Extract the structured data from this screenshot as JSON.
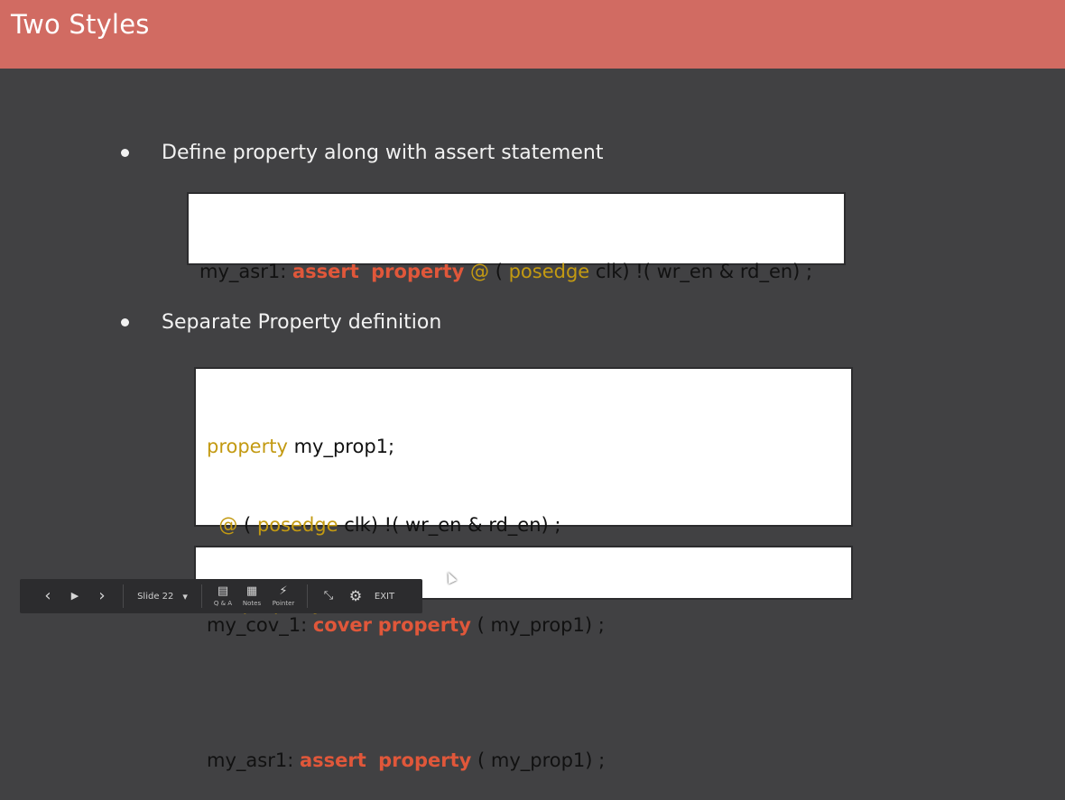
{
  "slide": {
    "title": "Two Styles",
    "bullets": [
      "Define property along with assert statement",
      "Separate Property definition"
    ],
    "code1": {
      "label": "my_asr1:",
      "kw_assert": "assert",
      "kw_property": "property",
      "at": "@",
      "paren_open": "(",
      "kw_posedge": "posedge",
      "rest": "clk) !( wr_en & rd_en) ;"
    },
    "code2": {
      "kw_property": "property",
      "prop_name": "my_prop1;",
      "at": "@",
      "paren_open": "(",
      "kw_posedge": "posedge",
      "rest": "clk) !( wr_en & rd_en) ;",
      "kw_endproperty": "endproperty",
      "label": "my_asr1:",
      "kw_assert": "assert",
      "kw_property2": "property",
      "call": "( my_prop1) ;"
    },
    "code3": {
      "label": "my_cov_1:",
      "kw_cover": "cover",
      "kw_property": "property",
      "call": "( my_prop1) ;"
    }
  },
  "toolbar": {
    "prev_icon": "‹",
    "play_icon": "▶",
    "next_icon": "›",
    "slide_label": "Slide 22",
    "dropdown_icon": "▾",
    "qa_icon": "▤",
    "qa_label": "Q & A",
    "notes_icon": "▦",
    "notes_label": "Notes",
    "pointer_icon": "⚡",
    "pointer_label": "Pointer",
    "exit_fullscreen_icon": "⤡",
    "settings_icon": "⚙",
    "exit_label": "EXIT"
  },
  "colors": {
    "header": "#d16b62",
    "background": "#414143",
    "keyword_red": "#e0573a",
    "keyword_gold": "#c39a12"
  }
}
